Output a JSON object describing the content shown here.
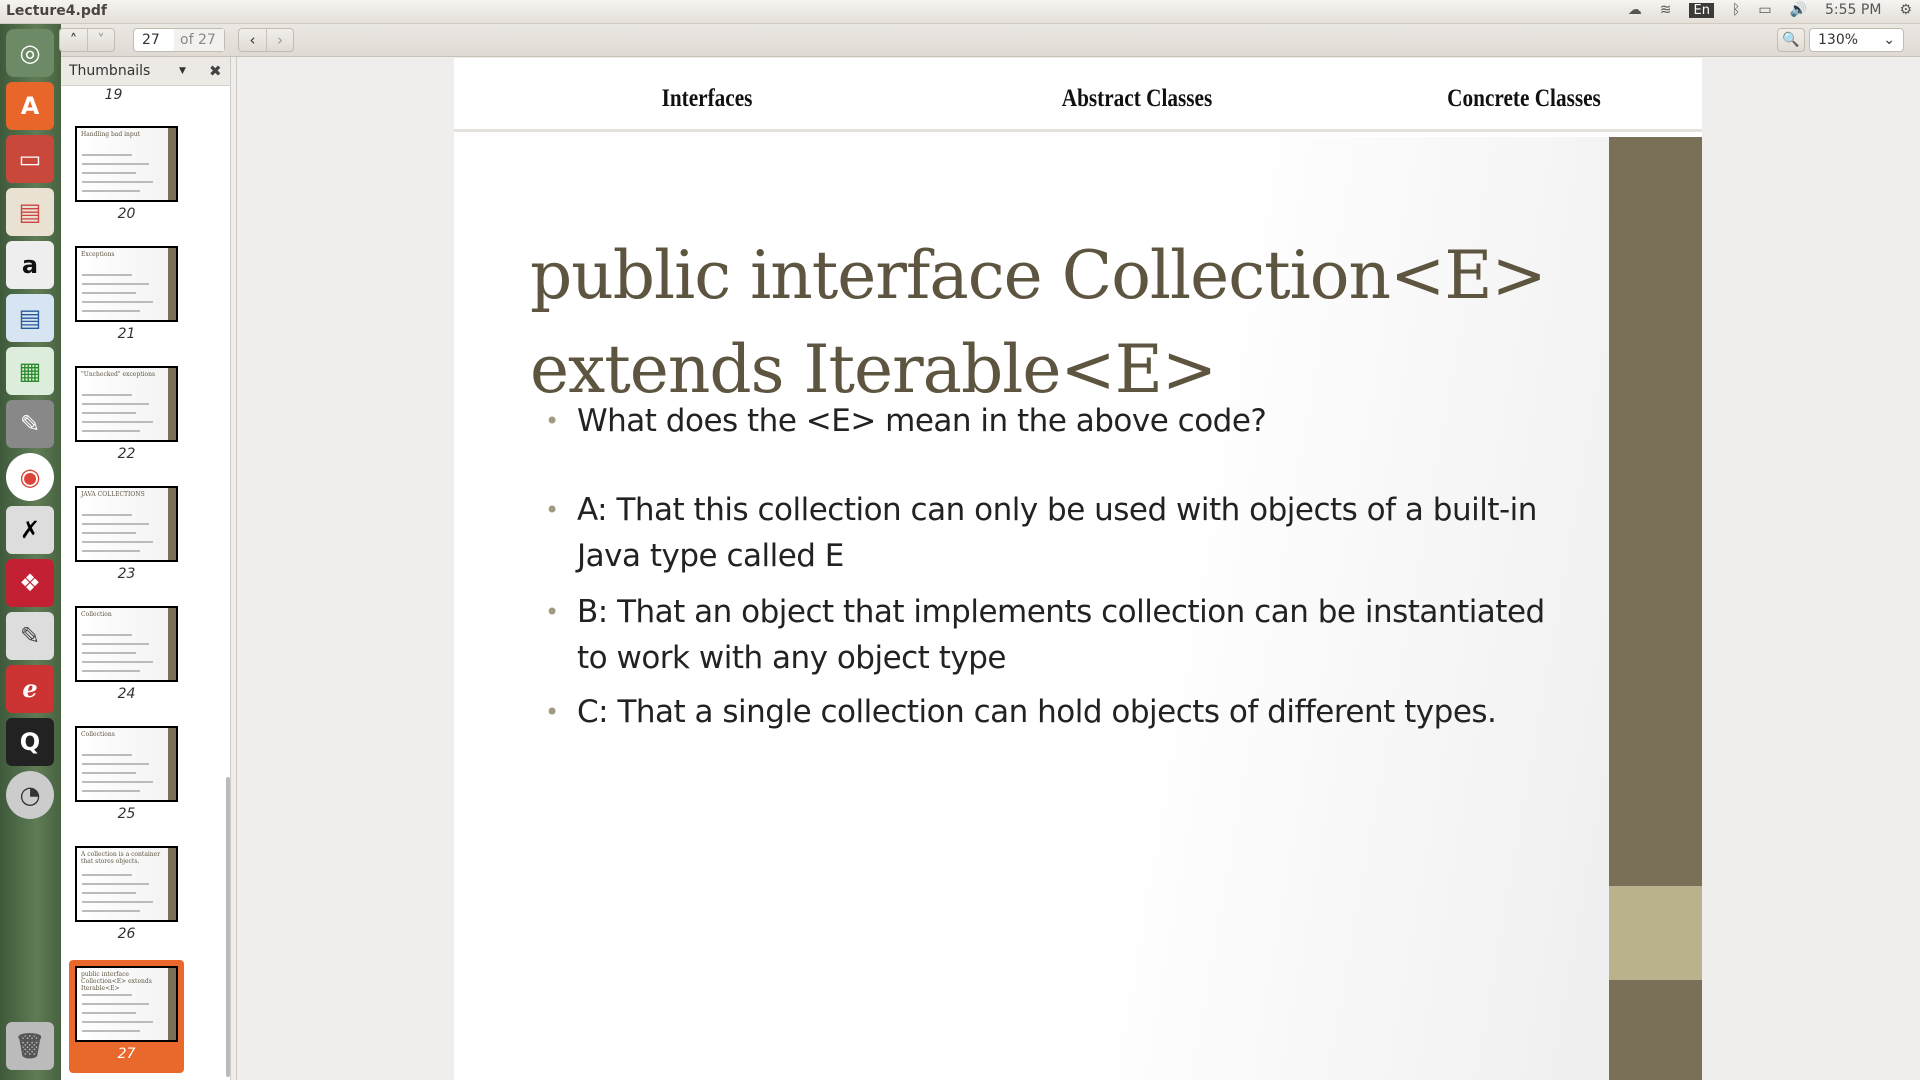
{
  "window": {
    "title": "Lecture4.pdf"
  },
  "tray": {
    "keyboard": "En",
    "time": "5:55 PM"
  },
  "toolbar": {
    "page_current": "27",
    "page_total": "of 27",
    "zoom": "130%"
  },
  "sidebar": {
    "mode": "Thumbnails",
    "first_label": "19",
    "thumbs": [
      {
        "num": "20",
        "title": "Handling bad input"
      },
      {
        "num": "21",
        "title": "Exceptions"
      },
      {
        "num": "22",
        "title": "\"Unchecked\" exceptions"
      },
      {
        "num": "23",
        "title": "JAVA COLLECTIONS"
      },
      {
        "num": "24",
        "title": "Collection"
      },
      {
        "num": "25",
        "title": "Collections"
      },
      {
        "num": "26",
        "title": "A collection is a container that stores objects."
      },
      {
        "num": "27",
        "title": "public interface Collection<E> extends Iterable<E>"
      }
    ]
  },
  "slide": {
    "header": [
      "Interfaces",
      "Abstract Classes",
      "Concrete Classes"
    ],
    "title_line1": "public interface Collection<E>",
    "title_line2": "extends Iterable<E>",
    "bullets": [
      "What does the <E> mean in the above code?",
      "A: That this collection can only be used with objects of a built-in Java type called E",
      "B: That an object that implements collection can be instantiated to work with any object type",
      "C: That a single collection can hold objects of different types."
    ]
  },
  "colors": {
    "accent": "#e9692c",
    "slide_bar": "#7a7057",
    "title": "#5d5540"
  }
}
